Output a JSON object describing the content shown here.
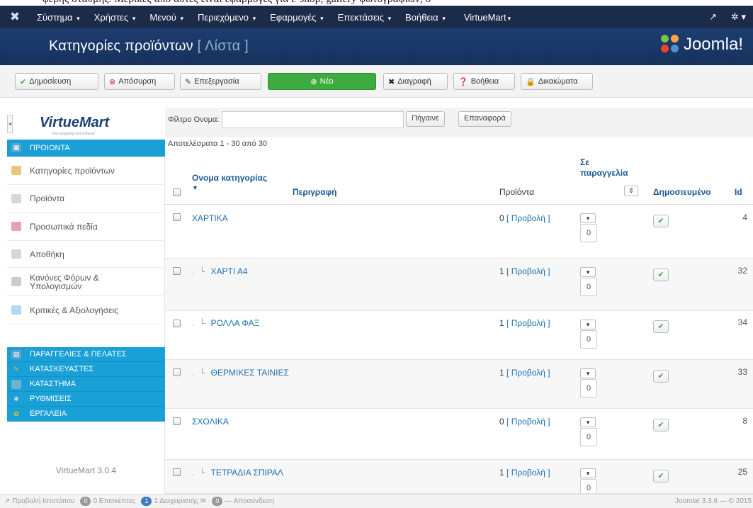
{
  "top_text": "φερής σταθμής. Μερικές από αυτές είναι εφαρμογές για e-shop, gallery φωτογραφιών, ο",
  "menubar": {
    "items": [
      "Σύστημα",
      "Χρήστες",
      "Μενού",
      "Περιεχόμενο",
      "Εφαρμογές",
      "Επεκτάσεις",
      "Βοήθεια",
      "VirtueMart"
    ]
  },
  "header": {
    "title": "Κατηγορίες προϊόντων",
    "subtitle": "[ Λίστα ]",
    "brand": "Joomla!"
  },
  "toolbar": {
    "publish": "Δημοσίευση",
    "unpublish": "Απόσυρση",
    "edit": "Επεξεργασία",
    "new": "Νέο",
    "delete": "Διαγραφή",
    "help": "Βοήθεια",
    "permissions": "Δικαιώματα"
  },
  "sidebar": {
    "logo": "VirtueMart",
    "tagline": "free shopping cart software",
    "items": [
      {
        "label": "ΠΡΟΙΟΝΤΑ",
        "style": "blue"
      },
      {
        "label": "Κατηγορίες προϊόντων",
        "style": "plain"
      },
      {
        "label": "Προϊόντα",
        "style": "plain"
      },
      {
        "label": "Προσωπικά πεδία",
        "style": "plain"
      },
      {
        "label": "Αποθήκη",
        "style": "plain"
      },
      {
        "label": "Κανόνες Φόρων & Υπολογισμών",
        "style": "plain"
      },
      {
        "label": "Κριτικές & Αξιολογήσεις",
        "style": "plain"
      },
      {
        "label": "ΠΑΡΑΓΓΕΛΙΕΣ & ΠΕΛΑΤΕΣ",
        "style": "blue"
      },
      {
        "label": "ΚΑΤΑΣΚΕΥΑΣΤΕΣ",
        "style": "blue"
      },
      {
        "label": "ΚΑΤΑΣΤΗΜΑ",
        "style": "blue"
      },
      {
        "label": "ΡΥΘΜΙΣΕΙΣ",
        "style": "blue"
      },
      {
        "label": "ΕΡΓΑΛΕΙΑ",
        "style": "blue"
      }
    ],
    "version": "VirtueMart 3.0.4"
  },
  "filter": {
    "label": "Φίλτρο Ονομα:",
    "value": "",
    "go": "Πήγαινε",
    "reset": "Επαναφορά"
  },
  "results": "Αποτελέσματα 1 - 30 από 30",
  "table": {
    "headers": {
      "name": "Ονομα κατηγορίας",
      "description": "Περιγραφή",
      "products": "Προϊόντα",
      "ordering": "Σε παραγγελία",
      "published": "Δημοσιευμένο",
      "id": "Id"
    },
    "rows": [
      {
        "name": "ΧΑΡΤΙΚΑ",
        "child": false,
        "count": "0",
        "view": "[ Προβολή ]",
        "order": "0",
        "id": "4"
      },
      {
        "name": "ΧΑΡΤΙ Α4",
        "child": true,
        "count": "1",
        "view": "[ Προβολή ]",
        "order": "0",
        "id": "32"
      },
      {
        "name": "ΡΟΛΛΑ ΦΑΞ",
        "child": true,
        "count": "1",
        "view": "[ Προβολή ]",
        "order": "0",
        "id": "34"
      },
      {
        "name": "ΘΕΡΜΙΚΕΣ ΤΑΙΝΙΕΣ",
        "child": true,
        "count": "1",
        "view": "[ Προβολή ]",
        "order": "0",
        "id": "33"
      },
      {
        "name": "ΣΧΟΛΙΚΑ",
        "child": false,
        "count": "0",
        "view": "[ Προβολή ]",
        "order": "0",
        "id": "8"
      },
      {
        "name": "ΤΕΤΡΑΔΙΑ ΣΠΙΡΑΛ",
        "child": true,
        "count": "1",
        "view": "[ Προβολή ]",
        "order": "0",
        "id": "25"
      }
    ]
  },
  "statusbar": {
    "view_site": "Προβολή Ιστοτόπου",
    "visitors_count": "0",
    "visitors": "0 Επισκέπτες",
    "admins_count": "1",
    "admins": "1 Διαχειριστής",
    "messages_count": "0",
    "logout": "— Αποσύνδεση",
    "version": "Joomla! 3.3.6 — © 2015"
  }
}
